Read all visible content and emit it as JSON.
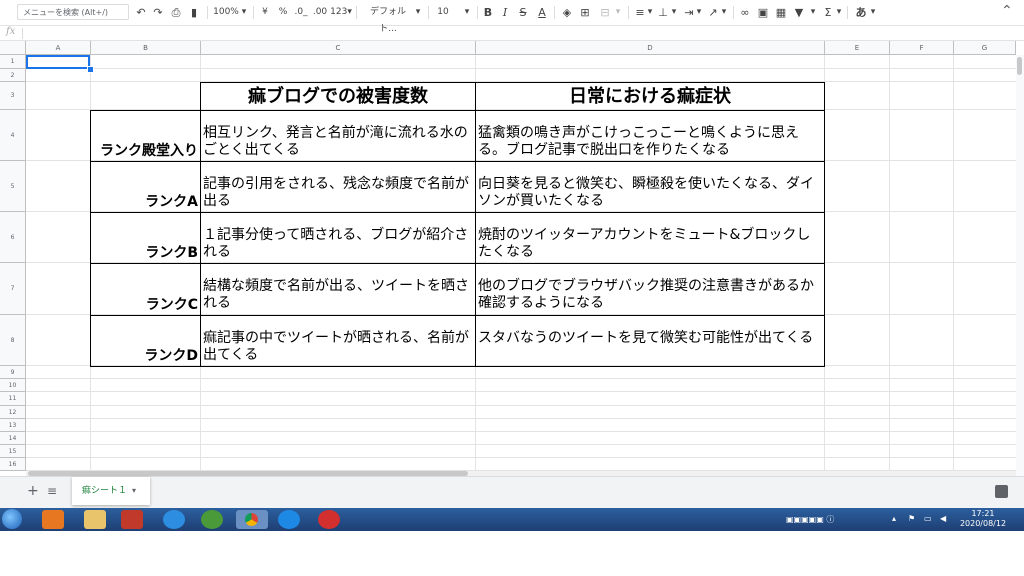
{
  "toolbar": {
    "menu_search_placeholder": "メニューを検索 (Alt+/)",
    "undo_icon": "undo-icon",
    "redo_icon": "redo-icon",
    "print_icon": "print-icon",
    "paint_format_icon": "paint-format-icon",
    "zoom": "100%",
    "currency": "¥",
    "percent": "%",
    "decimal_decrease": ".0_",
    "decimal_increase": ".00",
    "number_format": "123▾",
    "font": "デフォルト...",
    "font_size": "10",
    "bold": "B",
    "italic": "I",
    "strikethrough": "S",
    "text_color": "A",
    "input_tools": "あ"
  },
  "grid": {
    "columns": [
      "A",
      "B",
      "C",
      "D",
      "E",
      "F",
      "G"
    ],
    "rows": [
      "1",
      "2",
      "3",
      "4",
      "5",
      "6",
      "7",
      "8",
      "9",
      "10",
      "11",
      "12",
      "13",
      "14",
      "15",
      "16"
    ]
  },
  "table": {
    "headers": [
      "痲ブログでの被害度数",
      "日常における痲症状"
    ],
    "rows": [
      {
        "rank": "ランク殿堂入り",
        "damage": "相互リンク、発言と名前が滝に流れる水のごとく出てくる",
        "symptom": "猛禽類の鳴き声がこけっこっこーと鳴くように思える。ブログ記事で脱出口を作りたくなる"
      },
      {
        "rank": "ランクA",
        "damage": "記事の引用をされる、残念な頻度で名前が出る",
        "symptom": "向日葵を見ると微笑む、瞬極殺を使いたくなる、ダイソンが買いたくなる"
      },
      {
        "rank": "ランクB",
        "damage": "１記事分使って晒される、ブログが紹介される",
        "symptom": "焼酎のツイッターアカウントをミュート&ブロックしたくなる"
      },
      {
        "rank": "ランクC",
        "damage": "結構な頻度で名前が出る、ツイートを晒される",
        "symptom": "他のブログでブラウザバック推奨の注意書きがあるか確認するようになる"
      },
      {
        "rank": "ランクD",
        "damage": "痲記事の中でツイートが晒される、名前が出てくる",
        "symptom": "スタバなうのツイートを見て微笑む可能性が出てくる"
      }
    ]
  },
  "sheet_tab": {
    "name": "痲シート１"
  },
  "taskbar": {
    "time": "17:21",
    "date": "2020/08/12"
  }
}
